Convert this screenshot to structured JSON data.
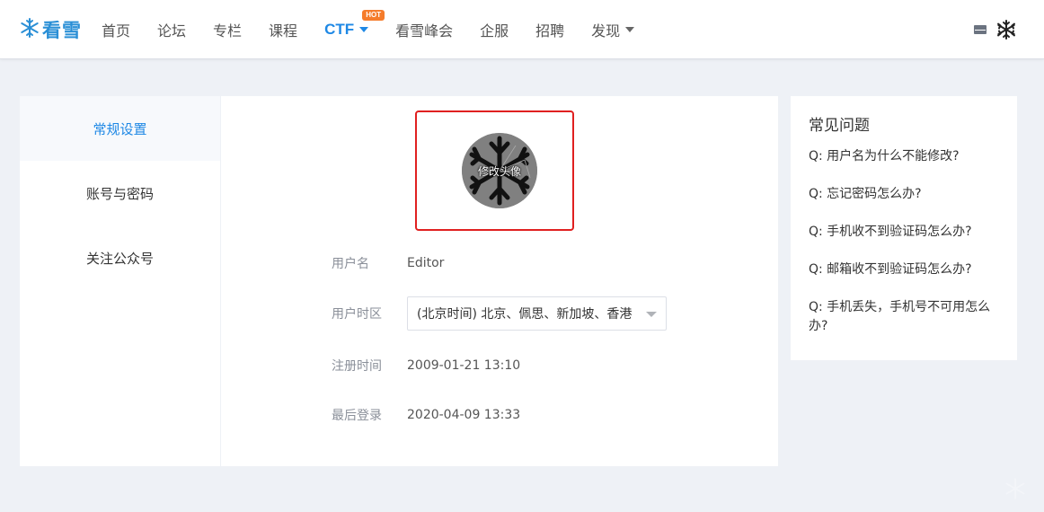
{
  "brand": {
    "logo_text": "看雪"
  },
  "nav": {
    "items": [
      {
        "label": "首页"
      },
      {
        "label": "论坛"
      },
      {
        "label": "专栏"
      },
      {
        "label": "课程"
      },
      {
        "label": "CTF",
        "badge": "HOT"
      },
      {
        "label": "看雪峰会"
      },
      {
        "label": "企服"
      },
      {
        "label": "招聘"
      },
      {
        "label": "发现"
      }
    ]
  },
  "side_menu": {
    "items": [
      {
        "label": "常规设置"
      },
      {
        "label": "账号与密码"
      },
      {
        "label": "关注公众号"
      }
    ]
  },
  "profile": {
    "avatar_overlay": "修改头像",
    "username_label": "用户名",
    "username_value": "Editor",
    "timezone_label": "用户时区",
    "timezone_value": "(北京时间) 北京、佩思、新加坡、香港",
    "registered_label": "注册时间",
    "registered_value": "2009-01-21 13:10",
    "last_login_label": "最后登录",
    "last_login_value": "2020-04-09 13:33"
  },
  "faq": {
    "title": "常见问题",
    "items": [
      {
        "text": "Q:  用户名为什么不能修改?"
      },
      {
        "text": "Q:  忘记密码怎么办?"
      },
      {
        "text": "Q:  手机收不到验证码怎么办?"
      },
      {
        "text": "Q:  邮箱收不到验证码怎么办?"
      },
      {
        "text": "Q:  手机丢失，手机号不可用怎么办?"
      }
    ]
  },
  "colors": {
    "accent": "#1e88e5",
    "brand": "#2a8fd6",
    "hot_badge": "#f57c2b",
    "highlight_border": "#e02020",
    "page_bg": "#eef1f6"
  },
  "icons": {
    "logo": "snowflake-logo-icon",
    "mail": "mail-icon",
    "user_avatar": "snowflake-avatar-icon"
  }
}
